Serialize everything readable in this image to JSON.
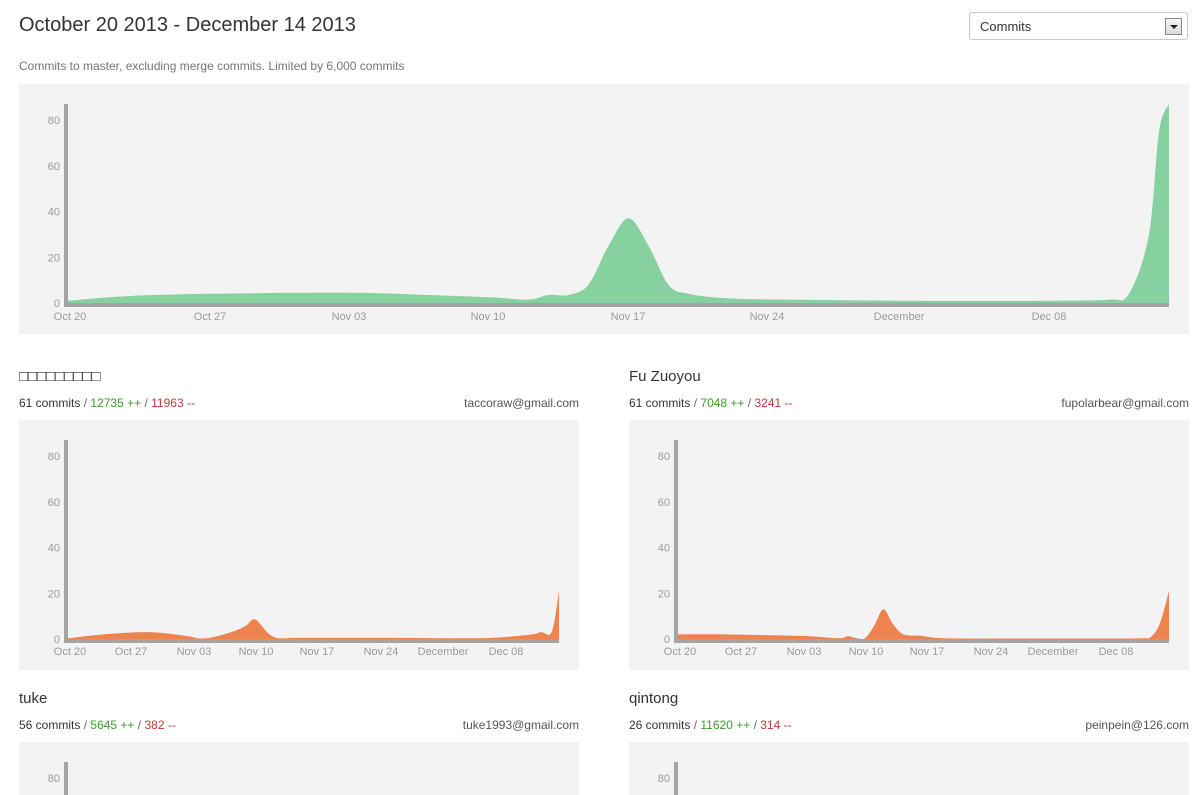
{
  "header": {
    "title": "October 20 2013 - December 14 2013",
    "select_value": "Commits",
    "subtitle": "Commits to master, excluding merge commits. Limited by 6,000 commits"
  },
  "colors": {
    "main_area": "#87d1a0",
    "contributor_area": "#f0824b",
    "axis": "#a4a4a4",
    "panel": "#f3f3f3"
  },
  "chart_data": [
    {
      "type": "area",
      "id": "overall",
      "x_ticks": [
        "Oct 20",
        "Oct 27",
        "Nov 03",
        "Nov 10",
        "Nov 17",
        "Nov 24",
        "December",
        "Dec 08"
      ],
      "y_ticks": [
        "0",
        "20",
        "40",
        "60",
        "80"
      ],
      "ylim": [
        0,
        90
      ],
      "x_days": [
        0,
        3,
        7,
        14,
        18,
        21,
        23,
        24,
        25,
        26,
        27,
        28,
        29,
        30,
        31,
        33,
        36,
        42,
        49,
        52,
        53,
        54,
        54.5,
        55
      ],
      "values": [
        1,
        3,
        4,
        4.5,
        3.5,
        2.5,
        1.5,
        3.5,
        3.5,
        8,
        25,
        37,
        25,
        8,
        4,
        2,
        1.5,
        1,
        1,
        1.5,
        4,
        30,
        75,
        87
      ]
    },
    {
      "type": "area",
      "id": "contributor-1",
      "x_ticks": [
        "Oct 20",
        "Oct 27",
        "Nov 03",
        "Nov 10",
        "Nov 17",
        "Nov 24",
        "December",
        "Dec 08"
      ],
      "y_ticks": [
        "0",
        "20",
        "40",
        "60",
        "80"
      ],
      "ylim": [
        0,
        90
      ],
      "x_days": [
        0,
        4,
        9,
        13,
        15,
        17,
        19,
        20,
        21,
        23,
        26,
        35,
        44,
        48,
        52,
        53,
        54,
        54.5,
        55
      ],
      "values": [
        0.3,
        2,
        3,
        1.5,
        0.2,
        1.5,
        4,
        6,
        8.5,
        1,
        0.5,
        0.5,
        0.3,
        0.6,
        2,
        3,
        2,
        8,
        21
      ]
    },
    {
      "type": "area",
      "id": "contributor-2",
      "x_ticks": [
        "Oct 20",
        "Oct 27",
        "Nov 03",
        "Nov 10",
        "Nov 17",
        "Nov 24",
        "December",
        "Dec 08"
      ],
      "y_ticks": [
        "0",
        "20",
        "40",
        "60",
        "80"
      ],
      "ylim": [
        0,
        90
      ],
      "x_days": [
        0,
        5,
        14,
        18,
        19,
        20,
        21,
        22,
        23,
        24,
        25,
        26,
        27,
        29,
        32,
        40,
        48,
        52,
        53,
        54,
        55
      ],
      "values": [
        2,
        2,
        1.3,
        0.3,
        1.2,
        0.3,
        0.5,
        6,
        13,
        7,
        2.5,
        1.5,
        1.5,
        0.5,
        0.2,
        0.2,
        0.2,
        0.3,
        1,
        7,
        21
      ]
    }
  ],
  "contributors": [
    {
      "name": "□□□□□□□□□",
      "commits": "61 commits",
      "additions": "12735 ++",
      "deletions": "11963 --",
      "email": "taccoraw@gmail.com"
    },
    {
      "name": "Fu Zuoyou",
      "commits": "61 commits",
      "additions": "7048 ++",
      "deletions": "3241 --",
      "email": "fupolarbear@gmail.com"
    },
    {
      "name": "tuke",
      "commits": "56 commits",
      "additions": "5645 ++",
      "deletions": "382 --",
      "email": "tuke1993@gmail.com"
    },
    {
      "name": "qintong",
      "commits": "26 commits",
      "additions": "11620 ++",
      "deletions": "314 --",
      "email": "peinpein@126.com"
    }
  ],
  "slash": "/"
}
